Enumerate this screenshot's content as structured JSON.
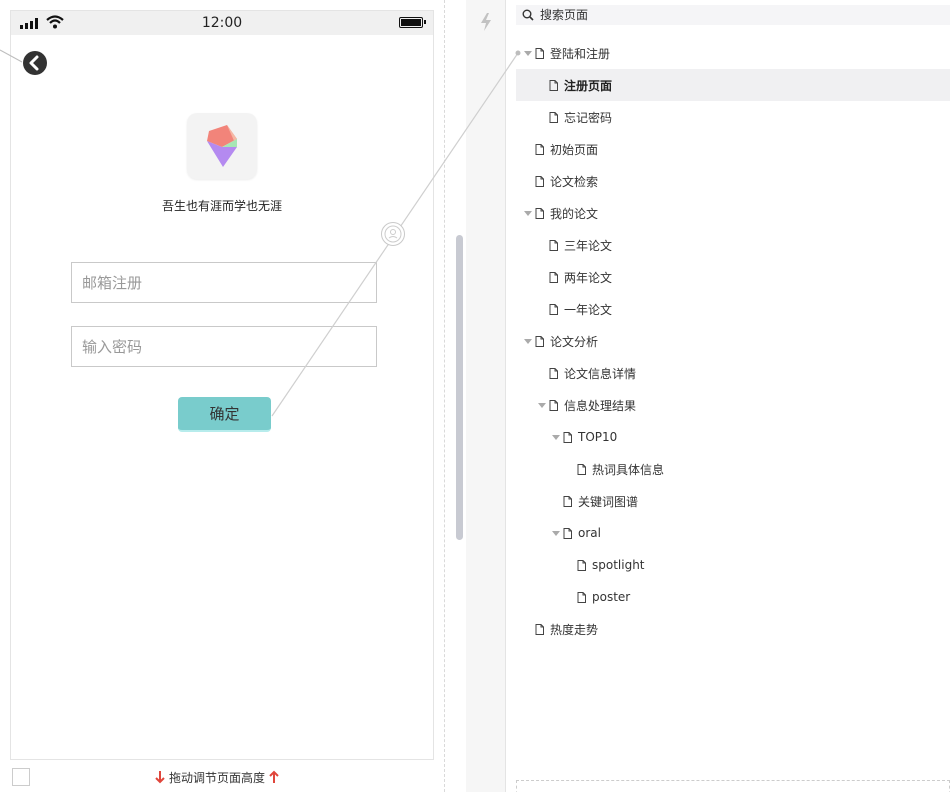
{
  "status_bar": {
    "time": "12:00"
  },
  "login": {
    "slogan": "吾生也有涯而学也无涯",
    "email_placeholder": "邮箱注册",
    "password_placeholder": "输入密码",
    "confirm_label": "确定"
  },
  "footer": {
    "hint": "拖动调节页面高度"
  },
  "search": {
    "placeholder": "搜索页面"
  },
  "tree": [
    {
      "label": "登陆和注册",
      "level": 0,
      "expanded": true
    },
    {
      "label": "注册页面",
      "level": 1,
      "selected": true
    },
    {
      "label": "忘记密码",
      "level": 1
    },
    {
      "label": "初始页面",
      "level": 0
    },
    {
      "label": "论文检索",
      "level": 0
    },
    {
      "label": "我的论文",
      "level": 0,
      "expanded": true
    },
    {
      "label": "三年论文",
      "level": 1
    },
    {
      "label": "两年论文",
      "level": 1
    },
    {
      "label": "一年论文",
      "level": 1
    },
    {
      "label": "论文分析",
      "level": 0,
      "expanded": true
    },
    {
      "label": "论文信息详情",
      "level": 1
    },
    {
      "label": "信息处理结果",
      "level": 1,
      "expanded": true
    },
    {
      "label": "TOP10",
      "level": 2,
      "expanded": true
    },
    {
      "label": "热词具体信息",
      "level": 3
    },
    {
      "label": "关键词图谱",
      "level": 2
    },
    {
      "label": "oral",
      "level": 2,
      "expanded": true
    },
    {
      "label": "spotlight",
      "level": 3
    },
    {
      "label": "poster",
      "level": 3
    },
    {
      "label": "热度走势",
      "level": 0
    }
  ],
  "colors": {
    "button": "#79cccc",
    "selected_row": "#f0f0f2",
    "arrow_red": "#e0463c"
  },
  "icons": [
    "signal-icon",
    "wifi-icon",
    "battery-icon",
    "back-icon",
    "app-logo",
    "link-handle-icon",
    "lightning-icon",
    "search-icon",
    "file-icon",
    "arrow-down-icon",
    "arrow-up-icon"
  ]
}
